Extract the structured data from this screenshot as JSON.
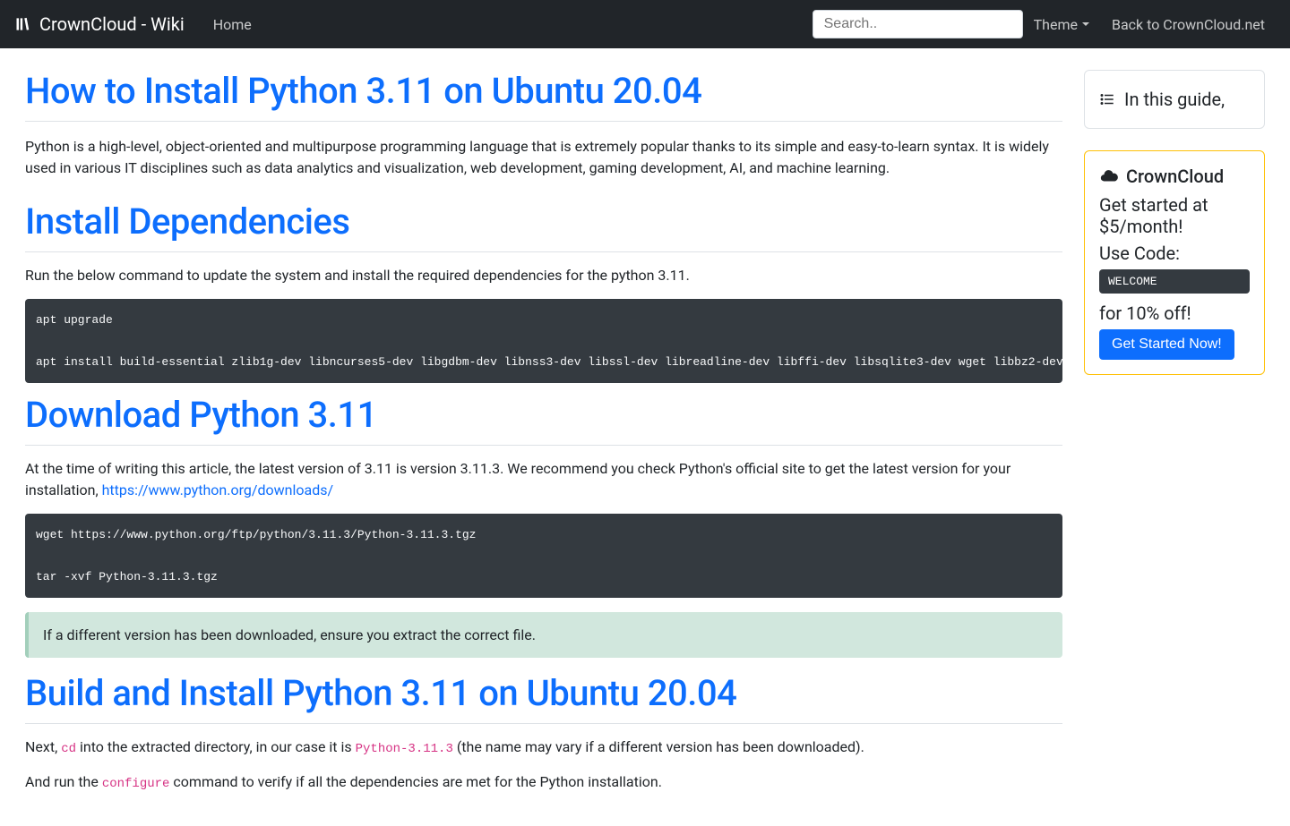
{
  "nav": {
    "brand": "CrownCloud - Wiki",
    "home": "Home",
    "search_placeholder": "Search..",
    "theme": "Theme",
    "back": "Back to CrownCloud.net"
  },
  "article": {
    "title": "How to Install Python 3.11 on Ubuntu 20.04",
    "intro": "Python is a high-level, object-oriented and multipurpose programming language that is extremely popular thanks to its simple and easy-to-learn syntax. It is widely used in various IT disciplines such as data analytics and visualization, web development, gaming development, AI, and machine learning.",
    "h2_deps": "Install Dependencies",
    "deps_text": "Run the below command to update the system and install the required dependencies for the python 3.11.",
    "deps_code": "apt upgrade\n\napt install build-essential zlib1g-dev libncurses5-dev libgdbm-dev libnss3-dev libssl-dev libreadline-dev libffi-dev libsqlite3-dev wget libbz2-dev",
    "h2_download": "Download Python 3.11",
    "download_text_pre": "At the time of writing this article, the latest version of 3.11 is version 3.11.3. We recommend you check Python's official site to get the latest version for your installation, ",
    "download_link": "https://www.python.org/downloads/",
    "download_code": "wget https://www.python.org/ftp/python/3.11.3/Python-3.11.3.tgz\n\ntar -xvf Python-3.11.3.tgz",
    "note": "If a different version has been downloaded, ensure you extract the correct file.",
    "h2_build": "Build and Install Python 3.11 on Ubuntu 20.04",
    "build_p1_pre": "Next, ",
    "build_p1_cd": "cd",
    "build_p1_mid": " into the extracted directory, in our case it is ",
    "build_p1_dir": "Python-3.11.3",
    "build_p1_post": " (the name may vary if a different version has been downloaded).",
    "build_p2_pre": "And run the ",
    "build_p2_cfg": "configure",
    "build_p2_post": " command to verify if all the dependencies are met for the Python installation."
  },
  "sidebar": {
    "toc_title": "In this guide,",
    "promo_brand": "CrownCloud",
    "promo_line1": "Get started at $5/month!",
    "promo_usecode": "Use Code:",
    "promo_code": "WELCOME",
    "promo_discount": "for 10% off!",
    "promo_cta": "Get Started Now!"
  }
}
